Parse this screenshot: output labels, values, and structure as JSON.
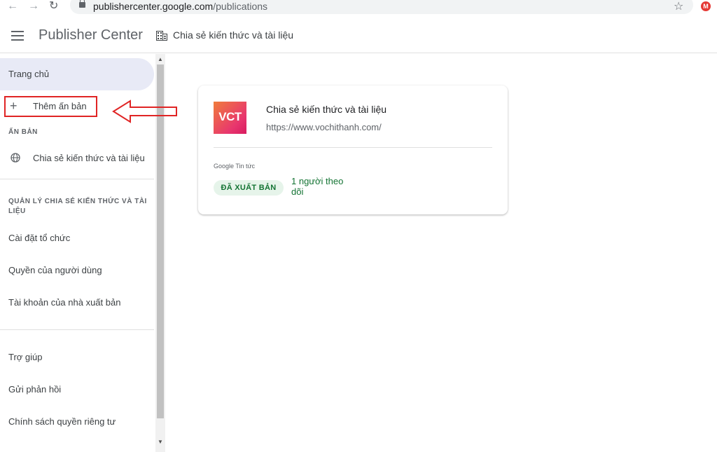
{
  "browser": {
    "url_host": "publishercenter.google.com",
    "url_path": "/publications",
    "extension_badge": "M"
  },
  "header": {
    "app_title": "Publisher Center",
    "org_name": "Chia sẻ kiến thức và tài liệu"
  },
  "sidebar": {
    "home": "Trang chủ",
    "add_publication": "Thêm ấn bản",
    "publications_section": "ẤN BẢN",
    "publication_item": "Chia sẻ kiến thức và tài liệu",
    "manage_section": "QUẢN LÝ CHIA SẺ KIẾN THỨC VÀ TÀI LIỆU",
    "org_settings": "Cài đặt tổ chức",
    "user_permissions": "Quyền của người dùng",
    "publisher_accounts": "Tài khoản của nhà xuất bản",
    "help": "Trợ giúp",
    "feedback": "Gửi phản hồi",
    "privacy": "Chính sách quyền riêng tư"
  },
  "card": {
    "logo_text": "VCT",
    "title": "Chia sẻ kiến thức và tài liệu",
    "url": "https://www.vochithanh.com/",
    "service": "Google Tin tức",
    "status_badge": "ĐÃ XUẤT BẢN",
    "followers": "1 người theo dõi"
  },
  "colors": {
    "accent_active_bg": "#e8eaf6",
    "status_green": "#137333",
    "annotation_red": "#e02424"
  }
}
